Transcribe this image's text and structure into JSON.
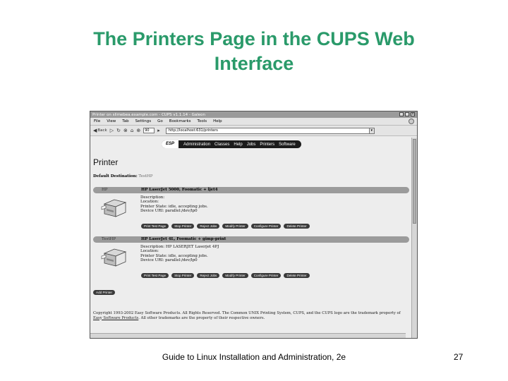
{
  "slide": {
    "title_line1": "The Printers Page in the CUPS Web",
    "title_line2": "Interface",
    "footer": "Guide to Linux Installation and Administration, 2e",
    "page_number": "27"
  },
  "window": {
    "title": "Printer on slimebea.example.com - CUPS v1.1.14 - Galeon",
    "menu": [
      "File",
      "View",
      "Tab",
      "Settings",
      "Go",
      "Bookmarks",
      "Tools",
      "Help"
    ],
    "toolbar": {
      "back_label": "Back",
      "zoom_value": "90",
      "url": "http://localhost:631/printers"
    }
  },
  "cups": {
    "nav": {
      "logo": "ESP",
      "tabs": [
        "Administration",
        "Classes",
        "Help",
        "Jobs",
        "Printers",
        "Software"
      ]
    },
    "heading": "Printer",
    "default_destination_label": "Default Destination:",
    "default_destination_value": "TestHP",
    "printers": [
      {
        "name": "HP",
        "model": "HP LaserJet 5000, Foomatic + ljet4",
        "info": [
          "Description:",
          "Location:",
          "Printer State: idle, accepting jobs.",
          "Device URI: parallel:/dev/lp0"
        ]
      },
      {
        "name": "TestHP",
        "model": "HP LaserJet 4L, Foomatic + gimp-print",
        "info": [
          "Description: HP LASERJET Laserjet 4PJ",
          "Location:",
          "Printer State: idle, accepting jobs.",
          "Device URI: parallel:/dev/lp0"
        ]
      }
    ],
    "buttons": [
      "Print Test Page",
      "Stop Printer",
      "Reject Jobs",
      "Modify Printer",
      "Configure Printer",
      "Delete Printer"
    ],
    "add_printer": "Add Printer",
    "copyright_prefix": "Copyright 1993-2002 Easy Software Products. All Rights Reserved. The Common UNIX Printing System, CUPS, and the CUPS logo are the trademark property of ",
    "copyright_link": "Easy Software Products",
    "copyright_suffix": ". All other trademarks are the property of their respective owners."
  }
}
